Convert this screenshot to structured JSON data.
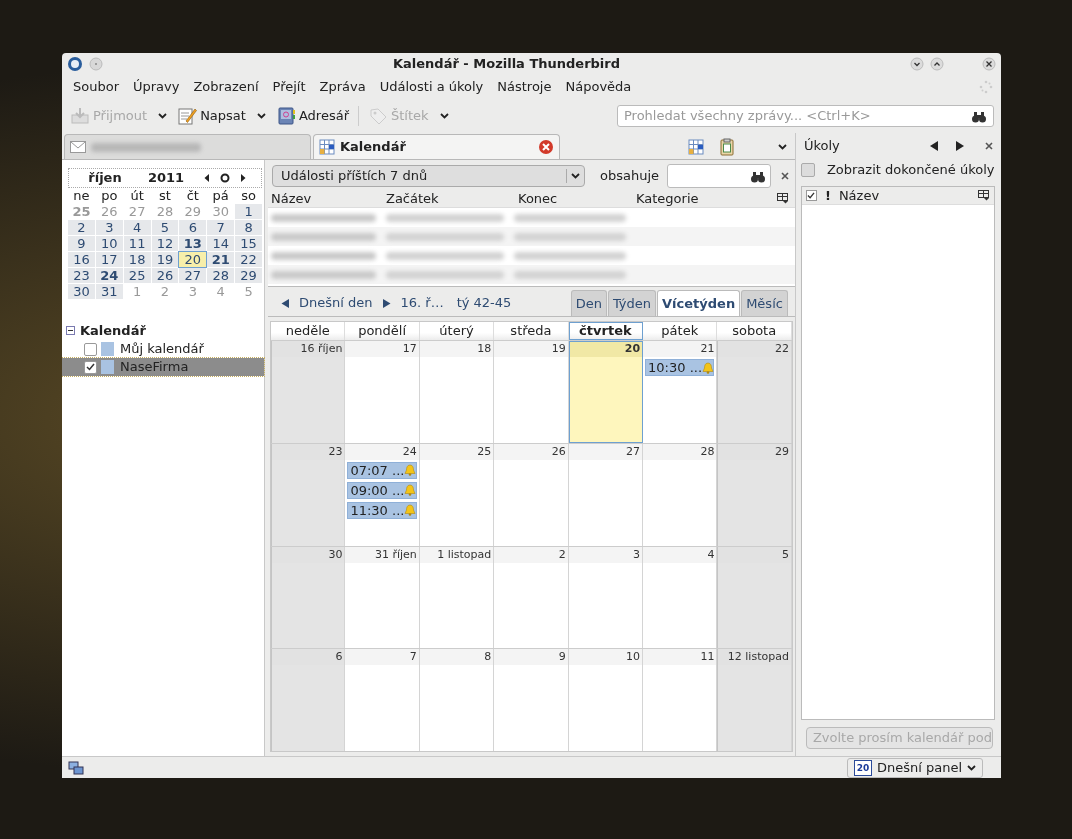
{
  "window": {
    "title": "Kalendář - Mozilla Thunderbird"
  },
  "menu": [
    "Soubor",
    "Úpravy",
    "Zobrazení",
    "Přejít",
    "Zpráva",
    "Události a úkoly",
    "Nástroje",
    "Nápověda"
  ],
  "toolbar": [
    {
      "kind": "get",
      "label": "Přijmout",
      "disabled": true,
      "dropdown": true
    },
    {
      "kind": "write",
      "label": "Napsat",
      "disabled": false,
      "dropdown": true
    },
    {
      "kind": "book",
      "label": "Adresář",
      "disabled": false,
      "dropdown": false
    },
    {
      "kind": "tag",
      "label": "Štítek",
      "disabled": true,
      "dropdown": true
    }
  ],
  "search": {
    "placeholder": "Prohledat všechny zprávy... <Ctrl+K>"
  },
  "tabs": [
    {
      "kind": "mail",
      "selected": false,
      "closable": false
    },
    {
      "kind": "calendar",
      "label": "Kalendář",
      "selected": true,
      "closable": true
    }
  ],
  "minical": {
    "month": "říjen",
    "year": "2011",
    "weekdays": [
      "ne",
      "po",
      "út",
      "st",
      "čt",
      "pá",
      "so"
    ],
    "days": [
      {
        "d": "25",
        "other": true,
        "bold": true,
        "today": false
      },
      {
        "d": "26",
        "other": true,
        "bold": false,
        "today": false
      },
      {
        "d": "27",
        "other": true,
        "bold": false,
        "today": false
      },
      {
        "d": "28",
        "other": true,
        "bold": false,
        "today": false
      },
      {
        "d": "29",
        "other": true,
        "bold": false,
        "today": false
      },
      {
        "d": "30",
        "other": true,
        "bold": false,
        "today": false
      },
      {
        "d": "1",
        "other": false,
        "bold": false,
        "today": false
      },
      {
        "d": "2",
        "other": false,
        "bold": false,
        "today": false
      },
      {
        "d": "3",
        "other": false,
        "bold": false,
        "today": false
      },
      {
        "d": "4",
        "other": false,
        "bold": false,
        "today": false
      },
      {
        "d": "5",
        "other": false,
        "bold": false,
        "today": false
      },
      {
        "d": "6",
        "other": false,
        "bold": false,
        "today": false
      },
      {
        "d": "7",
        "other": false,
        "bold": false,
        "today": false
      },
      {
        "d": "8",
        "other": false,
        "bold": false,
        "today": false
      },
      {
        "d": "9",
        "other": false,
        "bold": false,
        "today": false
      },
      {
        "d": "10",
        "other": false,
        "bold": false,
        "today": false
      },
      {
        "d": "11",
        "other": false,
        "bold": false,
        "today": false
      },
      {
        "d": "12",
        "other": false,
        "bold": false,
        "today": false
      },
      {
        "d": "13",
        "other": false,
        "bold": true,
        "today": false
      },
      {
        "d": "14",
        "other": false,
        "bold": false,
        "today": false
      },
      {
        "d": "15",
        "other": false,
        "bold": false,
        "today": false
      },
      {
        "d": "16",
        "other": false,
        "bold": false,
        "today": false
      },
      {
        "d": "17",
        "other": false,
        "bold": false,
        "today": false
      },
      {
        "d": "18",
        "other": false,
        "bold": false,
        "today": false
      },
      {
        "d": "19",
        "other": false,
        "bold": false,
        "today": false
      },
      {
        "d": "20",
        "other": false,
        "bold": false,
        "today": true
      },
      {
        "d": "21",
        "other": false,
        "bold": true,
        "today": false
      },
      {
        "d": "22",
        "other": false,
        "bold": false,
        "today": false
      },
      {
        "d": "23",
        "other": false,
        "bold": false,
        "today": false
      },
      {
        "d": "24",
        "other": false,
        "bold": true,
        "today": false
      },
      {
        "d": "25",
        "other": false,
        "bold": false,
        "today": false
      },
      {
        "d": "26",
        "other": false,
        "bold": false,
        "today": false
      },
      {
        "d": "27",
        "other": false,
        "bold": false,
        "today": false
      },
      {
        "d": "28",
        "other": false,
        "bold": false,
        "today": false
      },
      {
        "d": "29",
        "other": false,
        "bold": false,
        "today": false
      },
      {
        "d": "30",
        "other": false,
        "bold": false,
        "today": false
      },
      {
        "d": "31",
        "other": false,
        "bold": false,
        "today": false
      },
      {
        "d": "1",
        "other": true,
        "bold": false,
        "today": false
      },
      {
        "d": "2",
        "other": true,
        "bold": false,
        "today": false
      },
      {
        "d": "3",
        "other": true,
        "bold": false,
        "today": false
      },
      {
        "d": "4",
        "other": true,
        "bold": false,
        "today": false
      },
      {
        "d": "5",
        "other": true,
        "bold": false,
        "today": false
      }
    ]
  },
  "calendars": {
    "title": "Kalendář",
    "expanded": true,
    "items": [
      {
        "name": "Můj kalendář",
        "checked": false,
        "selected": false,
        "color": "#a9c3e2"
      },
      {
        "name": "NaseFirma",
        "checked": true,
        "selected": true,
        "color": "#a9c3e2"
      }
    ]
  },
  "filter": {
    "range": "Události příštích 7 dnů",
    "label": "obsahuje"
  },
  "event_list": {
    "columns": [
      "Název",
      "Začátek",
      "Konec",
      "Kategorie"
    ]
  },
  "nav": {
    "today": "Dnešní den",
    "date": "16. ř…",
    "weeks": "tý 42-45"
  },
  "views": [
    {
      "label": "Den",
      "selected": false
    },
    {
      "label": "Týden",
      "selected": false
    },
    {
      "label": "Vícetýden",
      "selected": true
    },
    {
      "label": "Měsíc",
      "selected": false
    }
  ],
  "grid": {
    "weekdays": [
      {
        "label": "neděle",
        "today": false
      },
      {
        "label": "pondělí",
        "today": false
      },
      {
        "label": "úterý",
        "today": false
      },
      {
        "label": "středa",
        "today": false
      },
      {
        "label": "čtvrtek",
        "today": true
      },
      {
        "label": "pátek",
        "today": false
      },
      {
        "label": "sobota",
        "today": false
      }
    ],
    "weeks": [
      [
        {
          "label": "16 říjen",
          "weekend": true,
          "today": false
        },
        {
          "label": "17",
          "weekend": false,
          "today": false
        },
        {
          "label": "18",
          "weekend": false,
          "today": false
        },
        {
          "label": "19",
          "weekend": false,
          "today": false
        },
        {
          "label": "20",
          "weekend": false,
          "today": true
        },
        {
          "label": "21",
          "weekend": false,
          "today": false,
          "events": [
            {
              "time": "10:30 ...",
              "alarm": true
            }
          ]
        },
        {
          "label": "22",
          "weekend": true,
          "today": false
        }
      ],
      [
        {
          "label": "23",
          "weekend": true,
          "today": false
        },
        {
          "label": "24",
          "weekend": false,
          "today": false,
          "events": [
            {
              "time": "07:07 ...",
              "alarm": true
            },
            {
              "time": "09:00 ...",
              "alarm": true
            },
            {
              "time": "11:30 ...",
              "alarm": true
            }
          ]
        },
        {
          "label": "25",
          "weekend": false,
          "today": false
        },
        {
          "label": "26",
          "weekend": false,
          "today": false
        },
        {
          "label": "27",
          "weekend": false,
          "today": false
        },
        {
          "label": "28",
          "weekend": false,
          "today": false
        },
        {
          "label": "29",
          "weekend": true,
          "today": false
        }
      ],
      [
        {
          "label": "30",
          "weekend": true,
          "today": false
        },
        {
          "label": "31 říjen",
          "weekend": false,
          "today": false
        },
        {
          "label": "1 listopad",
          "weekend": false,
          "today": false
        },
        {
          "label": "2",
          "weekend": false,
          "today": false
        },
        {
          "label": "3",
          "weekend": false,
          "today": false
        },
        {
          "label": "4",
          "weekend": false,
          "today": false
        },
        {
          "label": "5",
          "weekend": true,
          "today": false
        }
      ],
      [
        {
          "label": "6",
          "weekend": true,
          "today": false
        },
        {
          "label": "7",
          "weekend": false,
          "today": false
        },
        {
          "label": "8",
          "weekend": false,
          "today": false
        },
        {
          "label": "9",
          "weekend": false,
          "today": false
        },
        {
          "label": "10",
          "weekend": false,
          "today": false
        },
        {
          "label": "11",
          "weekend": false,
          "today": false
        },
        {
          "label": "12 listopad",
          "weekend": true,
          "today": false
        }
      ]
    ]
  },
  "tasks": {
    "title": "Úkoly",
    "show_completed": {
      "label": "Zobrazit dokončené úkoly",
      "checked": false
    },
    "priority_header": "!",
    "name_header": "Název",
    "button": {
      "label": "Zvolte prosím kalendář pod",
      "disabled": true
    }
  },
  "status_bar": {
    "today_pane": {
      "day": "20",
      "label": "Dnešní panel"
    }
  }
}
